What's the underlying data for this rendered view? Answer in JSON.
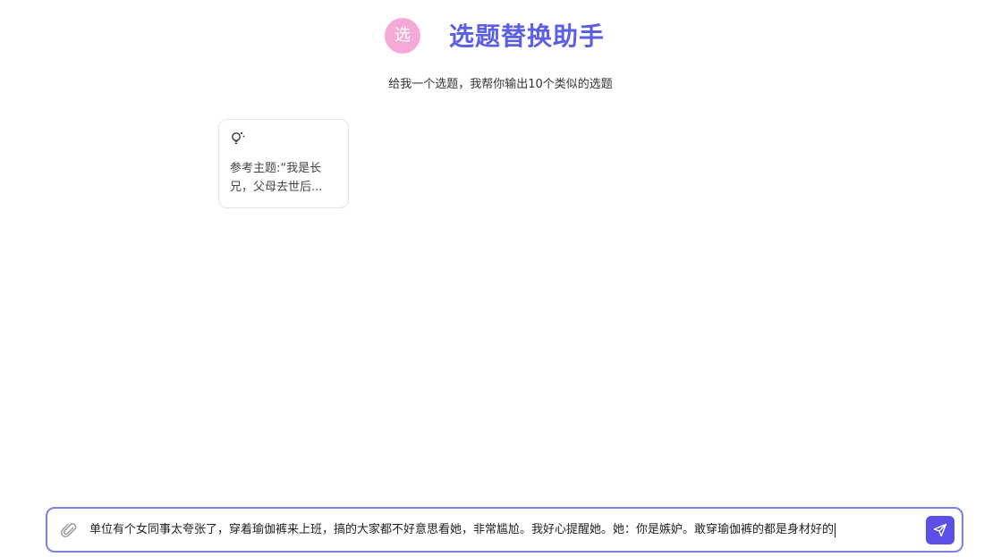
{
  "header": {
    "avatar_char": "选",
    "title": "选题替换助手"
  },
  "subtitle": "给我一个选题，我帮你输出10个类似的选题",
  "suggestions": [
    {
      "icon": "lightbulb-icon",
      "text": "参考主题:“我是长兄，父母去世后..."
    }
  ],
  "composer": {
    "attach_icon": "paperclip-icon",
    "value": "单位有个女同事太夸张了，穿着瑜伽裤来上班，搞的大家都不好意思看她，非常尴尬。我好心提醒她。她：你是嫉妒。敢穿瑜伽裤的都是身材好的",
    "send_icon": "send-icon"
  },
  "colors": {
    "accent": "#5b5fe8",
    "avatar_bg": "#f5a9d6",
    "send_bg": "#5b4fe8",
    "input_border": "#7c7ff0"
  }
}
